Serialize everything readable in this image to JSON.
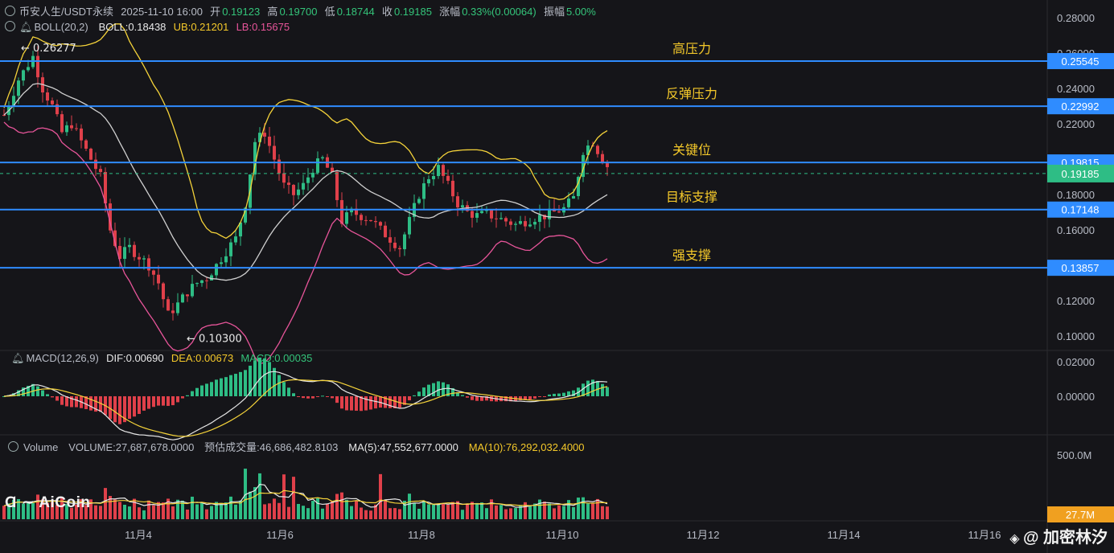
{
  "header": {
    "symbol": "币安人生/USDT永续",
    "datetime": "2025-11-10 16:00",
    "open_label": "开",
    "open": "0.19123",
    "high_label": "高",
    "high": "0.19700",
    "low_label": "低",
    "low": "0.18744",
    "close_label": "收",
    "close": "0.19185",
    "change_label": "涨幅",
    "change": "0.33%(0.00064)",
    "amp_label": "振幅",
    "amp": "5.00%"
  },
  "boll": {
    "label": "BOLL(20,2)",
    "mid": "BOLL:0.18438",
    "ub": "UB:0.21201",
    "lb": "LB:0.15675"
  },
  "macd": {
    "label": "MACD(12,26,9)",
    "dif": "DIF:0.00690",
    "dea": "DEA:0.00673",
    "macd": "MACD:0.00035"
  },
  "volume": {
    "label": "Volume",
    "vol": "VOLUME:27,687,678.0000",
    "est": "预估成交量:46,686,482.8103",
    "ma5": "MA(5):47,552,677.0000",
    "ma10": "MA(10):76,292,032.4000"
  },
  "watermark": "AiCoin",
  "author": "@ 加密林汐",
  "colors": {
    "bg": "#151519",
    "up": "#2ebd85",
    "down": "#e0404a",
    "level": "#2f8cff",
    "ub": "#f5d33a",
    "mid": "#d0d0d0",
    "lb": "#e8559a",
    "label": "#f5c92a",
    "last": "#2ebd85"
  },
  "chart_data": {
    "type": "candlestick",
    "price_axis": {
      "ticks": [
        0.28,
        0.26,
        0.24,
        0.22,
        0.2,
        0.18,
        0.16,
        0.14,
        0.12,
        0.1
      ],
      "tick_labels": [
        "0.28000",
        "0.26000",
        "0.24000",
        "0.22000",
        "0.20000",
        "0.18000",
        "0.16000",
        "0.14000",
        "0.12000",
        "0.10000"
      ]
    },
    "macd_axis": {
      "ticks": [
        0.02,
        0.0
      ],
      "tick_labels": [
        "0.02000",
        "0.00000"
      ]
    },
    "volume_axis": {
      "tick_labels": [
        "500.0M"
      ]
    },
    "x_axis": {
      "tick_labels": [
        "11月4",
        "11月6",
        "11月8",
        "11月10",
        "11月12",
        "11月14",
        "11月16"
      ]
    },
    "levels": [
      {
        "price": 0.25545,
        "label": "高压力",
        "tag": "0.25545"
      },
      {
        "price": 0.22992,
        "label": "反弹压力",
        "tag": "0.22992"
      },
      {
        "price": 0.19815,
        "label": "关键位",
        "tag": "0.19815"
      },
      {
        "price": 0.17148,
        "label": "目标支撑",
        "tag": "0.17148"
      },
      {
        "price": 0.13857,
        "label": "强支撑",
        "tag": "0.13857"
      }
    ],
    "last_price": {
      "price": 0.19185,
      "tag": "0.19185"
    },
    "annotations": [
      {
        "text": "← 0.26277",
        "price": 0.26277,
        "time": "11月3"
      },
      {
        "text": "← 0.10300",
        "price": 0.103,
        "time": "11月4-5"
      }
    ],
    "volume_last_tag": "27.7M",
    "price_path": [
      [
        0,
        0.225
      ],
      [
        3,
        0.245
      ],
      [
        6,
        0.258
      ],
      [
        8,
        0.24
      ],
      [
        10,
        0.23
      ],
      [
        12,
        0.215
      ],
      [
        14,
        0.22
      ],
      [
        16,
        0.21
      ],
      [
        18,
        0.2
      ],
      [
        20,
        0.19
      ],
      [
        22,
        0.16
      ],
      [
        24,
        0.145
      ],
      [
        26,
        0.15
      ],
      [
        28,
        0.145
      ],
      [
        30,
        0.14
      ],
      [
        32,
        0.13
      ],
      [
        34,
        0.112
      ],
      [
        36,
        0.118
      ],
      [
        38,
        0.125
      ],
      [
        40,
        0.13
      ],
      [
        42,
        0.133
      ],
      [
        44,
        0.14
      ],
      [
        46,
        0.148
      ],
      [
        48,
        0.155
      ],
      [
        50,
        0.175
      ],
      [
        52,
        0.21
      ],
      [
        54,
        0.215
      ],
      [
        56,
        0.2
      ],
      [
        58,
        0.185
      ],
      [
        60,
        0.18
      ],
      [
        62,
        0.185
      ],
      [
        64,
        0.195
      ],
      [
        66,
        0.2
      ],
      [
        68,
        0.19
      ],
      [
        70,
        0.165
      ],
      [
        72,
        0.17
      ],
      [
        74,
        0.168
      ],
      [
        76,
        0.166
      ],
      [
        78,
        0.16
      ],
      [
        80,
        0.155
      ],
      [
        82,
        0.15
      ],
      [
        84,
        0.165
      ],
      [
        86,
        0.18
      ],
      [
        88,
        0.19
      ],
      [
        90,
        0.195
      ],
      [
        92,
        0.185
      ],
      [
        94,
        0.175
      ],
      [
        96,
        0.17
      ],
      [
        98,
        0.168
      ],
      [
        100,
        0.169
      ],
      [
        102,
        0.167
      ],
      [
        104,
        0.165
      ],
      [
        106,
        0.163
      ],
      [
        108,
        0.165
      ],
      [
        110,
        0.167
      ],
      [
        112,
        0.168
      ],
      [
        114,
        0.17
      ],
      [
        116,
        0.172
      ],
      [
        118,
        0.178
      ],
      [
        120,
        0.205
      ],
      [
        122,
        0.21
      ],
      [
        124,
        0.2
      ],
      [
        126,
        0.192
      ]
    ]
  }
}
